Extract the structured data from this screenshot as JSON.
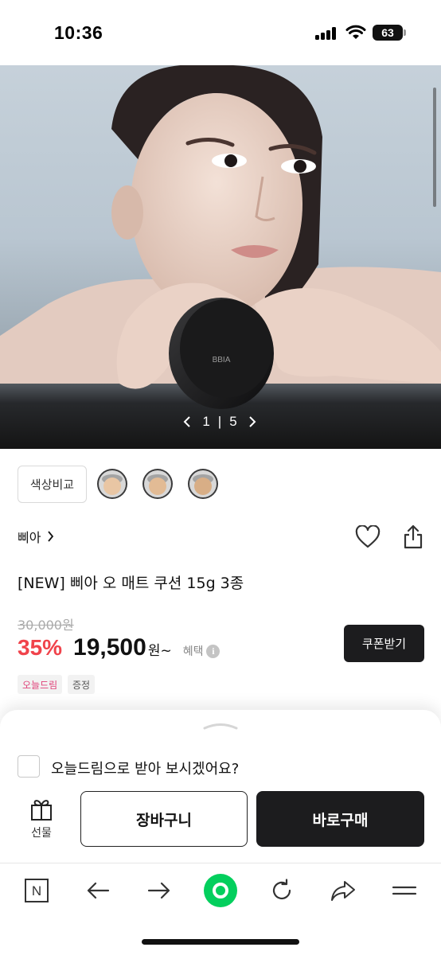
{
  "status": {
    "time": "10:36",
    "battery": "63"
  },
  "hero": {
    "current_page": "1",
    "separator": "|",
    "total_pages": "5",
    "logo_text": "BBIA"
  },
  "swatches": {
    "compare_label": "색상비교",
    "count": 3
  },
  "product": {
    "brand": "삐아",
    "title": "[NEW] 삐아 오 매트 쿠션 15g 3종",
    "original_price": "30,000원",
    "discount": "35%",
    "price": "19,500",
    "price_suffix": "원~",
    "benefit_label": "혜택",
    "coupon_label": "쿠폰받기",
    "tags": [
      "오늘드림",
      "증정"
    ]
  },
  "sheet": {
    "delivery_checkbox_label": "오늘드림으로 받아 보시겠어요?",
    "gift_label": "선물",
    "cart_label": "장바구니",
    "buy_label": "바로구매"
  },
  "toolbar": {
    "home_letter": "N"
  },
  "colors": {
    "discount": "#f0434b",
    "dark_button": "#1c1c1e",
    "naver_green": "#03cf5d",
    "tag_pink": "#e0437a"
  }
}
